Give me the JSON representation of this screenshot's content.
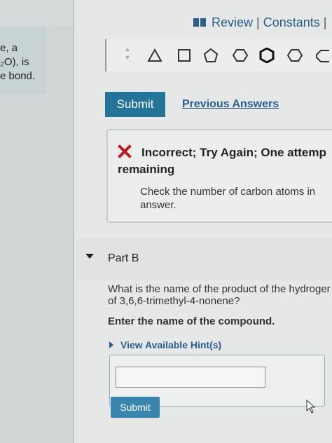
{
  "left": {
    "lines": [
      "e, a",
      "₂O), is",
      "e bond."
    ]
  },
  "header": {
    "review": "Review",
    "separator": "|",
    "constants": "Constants",
    "trailing_sep": "|"
  },
  "toolbar": {
    "shapes": [
      "triangle",
      "square",
      "pentagon",
      "hexagon",
      "bold-hexagon",
      "heptagon",
      "octagon"
    ]
  },
  "part_a": {
    "submit_label": "Submit",
    "previous_answers": "Previous Answers",
    "feedback": {
      "title_line1": "Incorrect; Try Again; One attemp",
      "title_line2": "remaining",
      "message_line1": "Check the number of carbon atoms in",
      "message_line2": "answer."
    }
  },
  "part_b": {
    "label": "Part B",
    "question_line1": "What is the name of the product of the hydroger",
    "question_line2": "of 3,6,6-trimethyl-4-nonene?",
    "instruction": "Enter the name of the compound.",
    "hint": "View Available Hint(s)",
    "answer_value": "",
    "submit_label": "Submit"
  },
  "colors": {
    "accent": "#24749a",
    "link": "#2a5d8c",
    "error": "#c0161c"
  }
}
